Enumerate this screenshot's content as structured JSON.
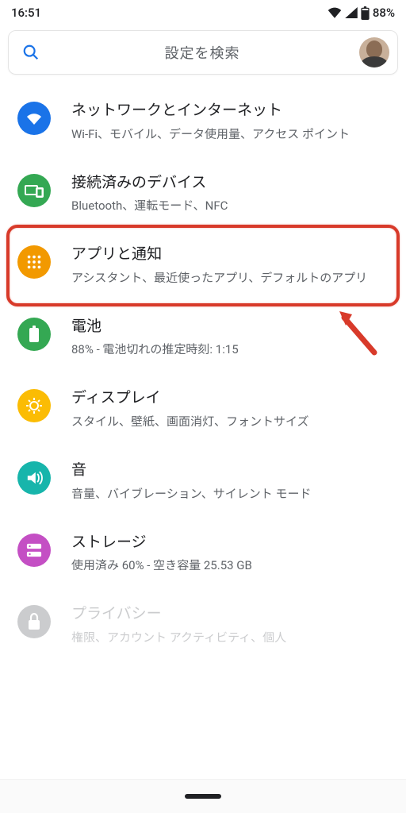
{
  "status": {
    "time": "16:51",
    "battery_pct": "88%"
  },
  "search": {
    "placeholder": "設定を検索"
  },
  "items": [
    {
      "title": "ネットワークとインターネット",
      "sub": "Wi-Fi、モバイル、データ使用量、アクセス ポイント",
      "color": "#1a73e8"
    },
    {
      "title": "接続済みのデバイス",
      "sub": "Bluetooth、運転モード、NFC",
      "color": "#34a853"
    },
    {
      "title": "アプリと通知",
      "sub": "アシスタント、最近使ったアプリ、デフォルトのアプリ",
      "color": "#f29900"
    },
    {
      "title": "電池",
      "sub": "88% - 電池切れの推定時刻: 1:15",
      "color": "#34a853"
    },
    {
      "title": "ディスプレイ",
      "sub": "スタイル、壁紙、画面消灯、フォントサイズ",
      "color": "#fbbc04"
    },
    {
      "title": "音",
      "sub": "音量、バイブレーション、サイレント モード",
      "color": "#17b5ab"
    },
    {
      "title": "ストレージ",
      "sub": "使用済み 60% - 空き容量 25.53 GB",
      "color": "#c44fc4"
    },
    {
      "title": "プライバシー",
      "sub": "権限、アカウント アクティビティ、個人",
      "color": "#5f6368"
    }
  ]
}
